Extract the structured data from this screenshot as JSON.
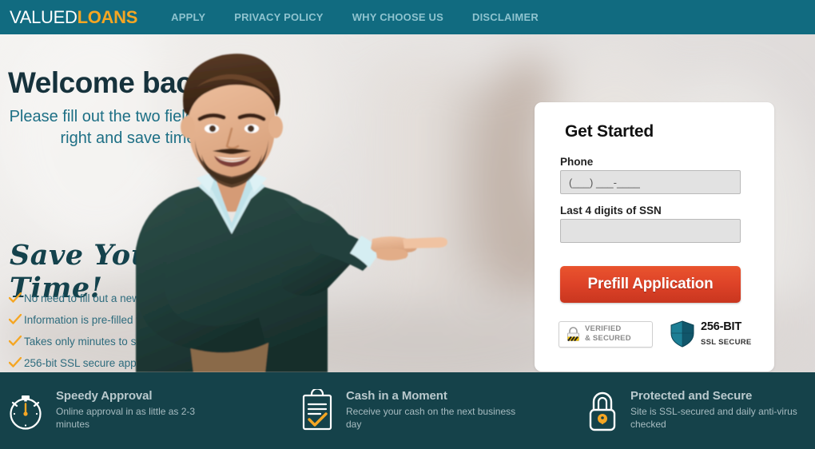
{
  "header": {
    "logo_primary": "VALUED",
    "logo_accent": "LOANS",
    "nav": [
      {
        "label": "APPLY"
      },
      {
        "label": "PRIVACY POLICY"
      },
      {
        "label": "WHY CHOOSE US"
      },
      {
        "label": "DISCLAIMER"
      }
    ]
  },
  "hero": {
    "headline": "Welcome back!",
    "subhead": "Please fill out the two fields to the right and save time",
    "script_text": "Save Your Time!",
    "bullets": [
      {
        "text": "No need to fill out a new application"
      },
      {
        "text": "Information is pre-filled for you"
      },
      {
        "text": "Takes only minutes to submit"
      },
      {
        "text": "256-bit SSL secure application"
      }
    ]
  },
  "form": {
    "title": "Get Started",
    "phone_label": "Phone",
    "phone_placeholder": "(___) ___-____",
    "phone_value": "",
    "ssn_label": "Last 4 digits of SSN",
    "ssn_placeholder": "",
    "ssn_value": "",
    "submit_label": "Prefill Application",
    "badges": {
      "verified_line1": "VERIFIED",
      "verified_line2": "& SECURED",
      "ssl_line1": "256-BIT",
      "ssl_line2": "SSL SECURE"
    }
  },
  "footer": {
    "items": [
      {
        "icon": "stopwatch-icon",
        "title": "Speedy Approval",
        "desc": "Online approval in as little as 2-3 minutes"
      },
      {
        "icon": "clipboard-check-icon",
        "title": "Cash in a Moment",
        "desc": "Receive your cash on the next business day"
      },
      {
        "icon": "padlock-icon",
        "title": "Protected and Secure",
        "desc": "Site is SSL-secured and daily anti-virus checked"
      }
    ]
  },
  "colors": {
    "header_teal": "#116b80",
    "footer_teal": "#15424a",
    "accent_orange": "#f5a623",
    "cta_red": "#de4328",
    "hero_bg": "#e1dfde",
    "text_teal": "#1d6f85"
  }
}
